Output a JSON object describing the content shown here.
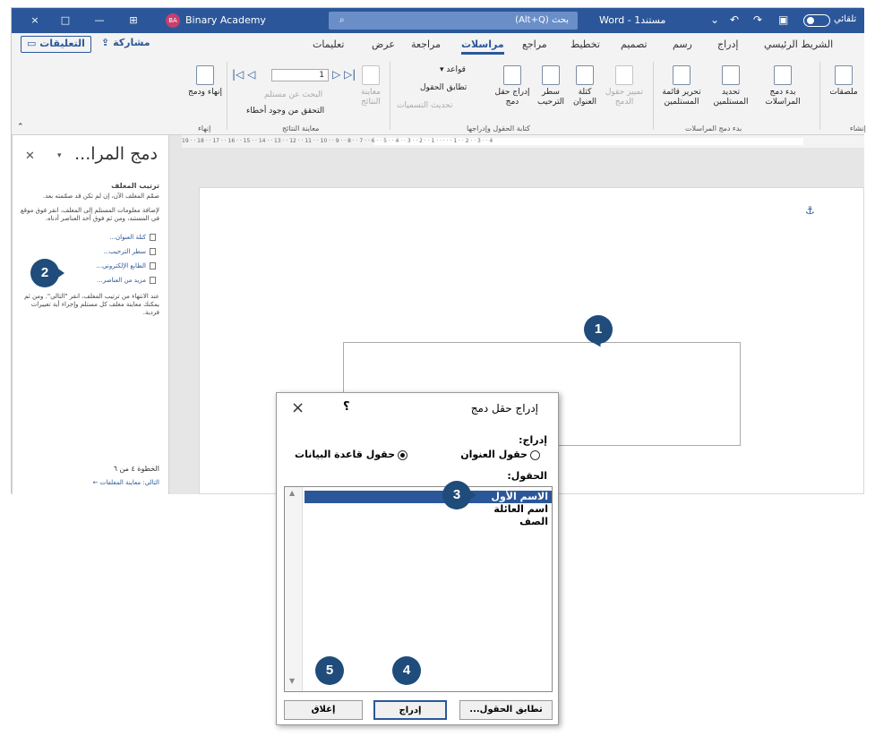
{
  "titlebar": {
    "window_buttons": [
      "×",
      "□",
      "—",
      "⊞"
    ],
    "avatar_initials": "BA",
    "account": "Binary Academy",
    "search_text": "بحث (Alt+Q)",
    "doc_name": "Word - مستند1",
    "autosave": "تلقائي"
  },
  "tabs": [
    "الشريط الرئيسي",
    "إدراج",
    "رسم",
    "تصميم",
    "تخطيط",
    "مراجع",
    "مراسلات",
    "مراجعة",
    "عرض",
    "تعليمات"
  ],
  "active_tab": "مراسلات",
  "share_label": "مشاركة",
  "comments_label": "التعليقات",
  "ribbon": {
    "labels_btn": "ملصقات",
    "start_merge": "بدء دمج المراسلات",
    "select_recipients": "تحديد المستلمين",
    "edit_list": "تحرير قائمة المستلمين",
    "highlight_fields": "تمييز حقول الدمج",
    "address_block": "كتلة العنوان",
    "greeting_line": "سطر الترحيب",
    "insert_field": "إدراج حقل دمج",
    "rules": "قواعد",
    "match_fields": "تطابق الحقول",
    "update_labels": "تحديث التسميات",
    "preview_results": "معاينة النتائج",
    "find_recipient": "البحث عن مستلم",
    "check_errors": "التحقق من وجود أخطاء",
    "record_value": "1",
    "finish_merge": "إنهاء ودمج",
    "groups": {
      "start": "بدء دمج المراسلات",
      "write": "كتابة الحقول وإدراجها",
      "preview": "معاينة النتائج",
      "finish": "إنهاء",
      "create": "إنشاء"
    }
  },
  "ruler_text": "19 · · 18 · · 17 · · 16 · · 15 · · 14 · · 13 · · 12 · · 11 · · 10 · · 9 · · 8 · · 7 · · 6 · · 5 · · 4 · · 3 · · 2 · · 1 · · · · · 1 · · 2 · · 3 · · 4",
  "pane": {
    "title": "دمج المرا...",
    "section": "ترتيب المغلف",
    "intro": "صمّم المغلف الآن، إن لم تكن قد صمّمته بعد.",
    "instructions": "لإضافة معلومات المستلم إلى المغلف، انقر فوق موقع في المستند، ومن ثم فوق أحد العناصر أدناه.",
    "links": [
      "كتلة العنوان...",
      "سطر الترحيب...",
      "الطابع الإلكتروني...",
      "مزيد من العناصر..."
    ],
    "after": "عند الانتهاء من ترتيب المغلف، انقر \"التالي\". ومن ثم يمكنك معاينة مغلف كل مستلم وإجراء أية تغييرات فردية.",
    "step": "الخطوة ٤ من ٦",
    "next": "التالي: معاينة المغلفات"
  },
  "dialog": {
    "title": "إدراج حقل دمج",
    "help": "؟",
    "close": "×",
    "insert_label": "إدراج:",
    "radio_address": "حقول العنوان",
    "radio_database": "حقول قاعدة البيانات",
    "selected_radio": "database",
    "fields_label": "الحقول:",
    "fields": [
      "الاسم الأول",
      "اسم العائلة",
      "الصف"
    ],
    "selected_field_index": 0,
    "match_button": "تطابق الحقول...",
    "insert_button": "إدراج",
    "close_button": "إغلاق"
  },
  "callouts": [
    "1",
    "2",
    "3",
    "4",
    "5"
  ],
  "colors": {
    "accent": "#2b579a",
    "callout": "#1f4c7a"
  }
}
